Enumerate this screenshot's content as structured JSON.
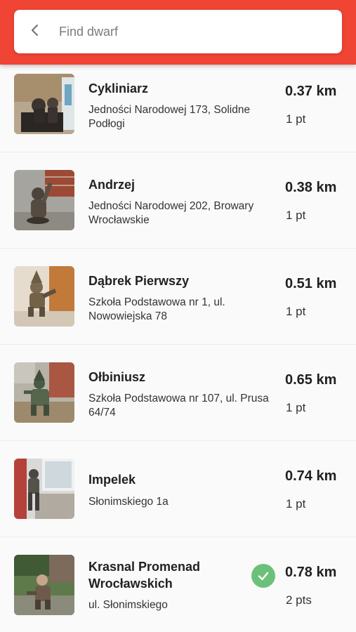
{
  "search": {
    "placeholder": "Find dwarf",
    "value": ""
  },
  "colors": {
    "header": "#f04435",
    "visited_badge": "#6cc17a"
  },
  "dwarfs": [
    {
      "name": "Cykliniarz",
      "address": "Jedności Narodowej 173, Solidne Podłogi",
      "distance": "0.37 km",
      "points": "1 pt",
      "visited": false
    },
    {
      "name": "Andrzej",
      "address": "Jedności Narodowej 202, Browary Wrocławskie",
      "distance": "0.38 km",
      "points": "1 pt",
      "visited": false
    },
    {
      "name": "Dąbrek Pierwszy",
      "address": "Szkoła Podstawowa nr 1, ul. Nowowiejska 78",
      "distance": "0.51 km",
      "points": "1 pt",
      "visited": false
    },
    {
      "name": "Ołbiniusz",
      "address": "Szkoła Podstawowa nr 107, ul. Prusa 64/74",
      "distance": "0.65 km",
      "points": "1 pt",
      "visited": false
    },
    {
      "name": "Impelek",
      "address": "Słonimskiego 1a",
      "distance": "0.74 km",
      "points": "1 pt",
      "visited": false
    },
    {
      "name": "Krasnal Promenad Wrocławskich",
      "address": "ul. Słonimskiego",
      "distance": "0.78 km",
      "points": "2 pts",
      "visited": true
    }
  ]
}
